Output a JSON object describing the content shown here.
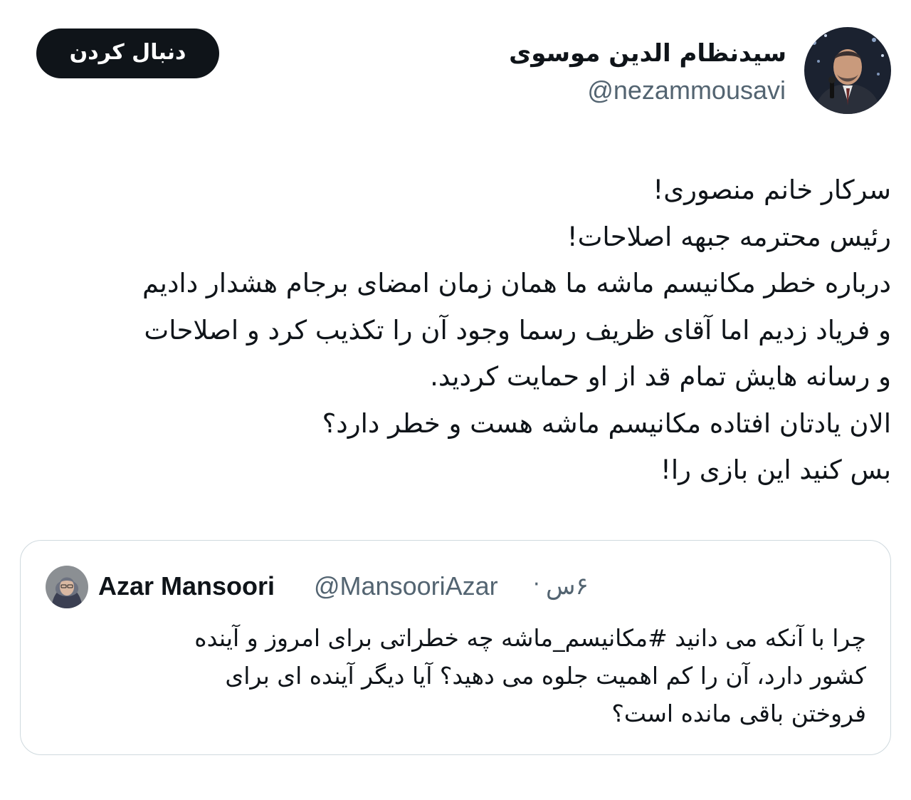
{
  "header": {
    "follow_label": "دنبال کردن",
    "display_name": "سیدنظام الدین موسوی",
    "handle": "@nezammousavi"
  },
  "tweet": {
    "lines": [
      "سرکار خانم منصوری!",
      "رئیس محترمه جبهه اصلاحات!",
      "درباره خطر مکانیسم ماشه ما همان زمان امضای برجام هشدار دادیم",
      "و فریاد زدیم اما آقای ظریف رسما وجود آن را تکذیب کرد و اصلاحات",
      "و رسانه هایش تمام قد از او حمایت کردید.",
      "الان یادتان افتاده مکانیسم ماشه هست و خطر دارد؟",
      "بس کنید این بازی را!"
    ]
  },
  "quote": {
    "name": "Azar Mansoori",
    "handle": "@MansooriAzar",
    "separator": "·",
    "time": "۶س",
    "lines": [
      "چرا با آنکه می دانید #مکانیسم_ماشه چه خطراتی برای امروز و آینده",
      "کشور دارد، آن را کم اهمیت جلوه می دهید؟ آیا دیگر آینده ای برای",
      "فروختن باقی مانده است؟"
    ]
  },
  "colors": {
    "text": "#0f1419",
    "secondary": "#536471",
    "border": "#cfd9de",
    "button_bg": "#0f1419"
  }
}
